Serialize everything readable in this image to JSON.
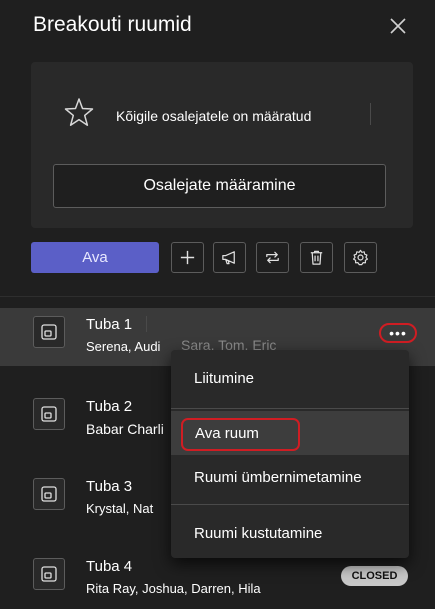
{
  "header": {
    "title": "Breakouti ruumid"
  },
  "card": {
    "message": "Kõigile osalejatele on määratud",
    "assign_button": "Osalejate määramine"
  },
  "toolbar": {
    "open_button": "Ava"
  },
  "rooms": [
    {
      "name": "Tuba 1",
      "people": "Serena, Audi",
      "people_more": "Sara, Tom, Eric"
    },
    {
      "name": "Tuba 2",
      "people": "Babar Charli"
    },
    {
      "name": "Tuba 3",
      "people": "Krystal, Nat"
    },
    {
      "name": "Tuba 4",
      "people": "Rita Ray, Joshua, Darren, Hila",
      "status": "CLOSED"
    }
  ],
  "more_menu": {
    "glyph": "•••"
  },
  "menu": {
    "items": [
      "Liitumine",
      "Ava ruum",
      "Ruumi ümbernimetamine",
      "Ruumi kustutamine"
    ]
  },
  "colors": {
    "accent": "#5b5fc7",
    "highlight": "#d01d23",
    "background": "#1f1f1f"
  }
}
